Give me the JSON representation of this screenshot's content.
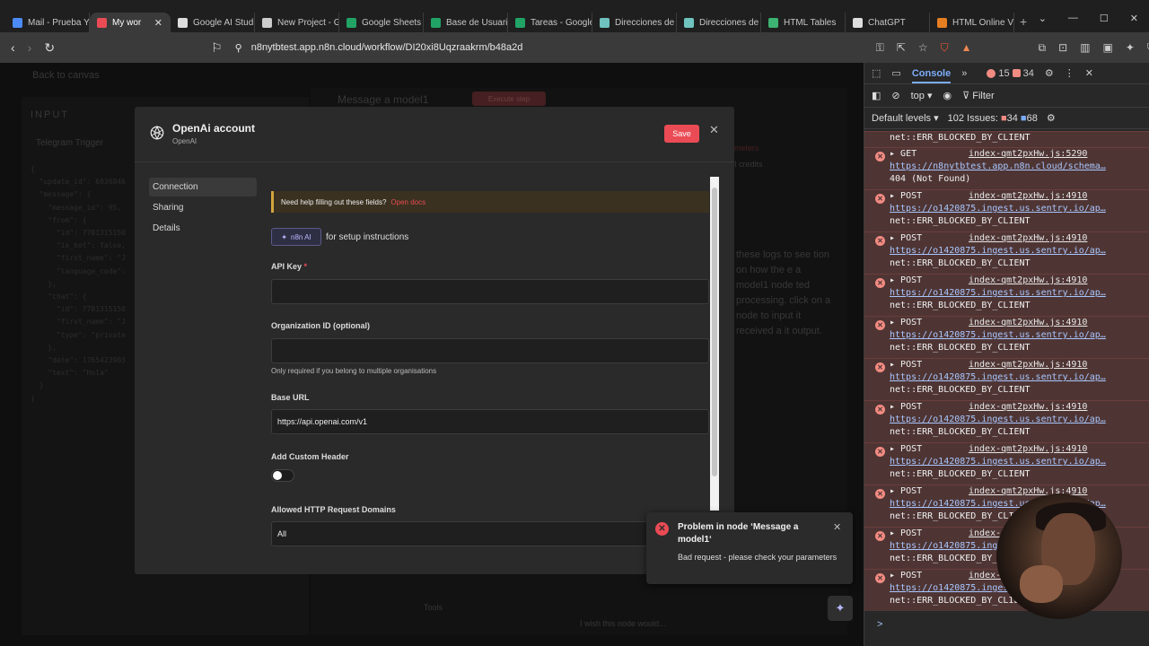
{
  "browser": {
    "tabs": [
      {
        "label": "Mail - Prueba Y",
        "color": "#4c8bf5"
      },
      {
        "label": "My wor",
        "color": "#ea4b54",
        "active": true
      },
      {
        "label": "Google AI Studi",
        "color": "#dddddd"
      },
      {
        "label": "New Project - G",
        "color": "#cccccc"
      },
      {
        "label": "Google Sheets",
        "color": "#21a366"
      },
      {
        "label": "Base de Usuario",
        "color": "#21a366"
      },
      {
        "label": "Tareas - Google",
        "color": "#21a366"
      },
      {
        "label": "Direcciones de",
        "color": "#6fc3bf"
      },
      {
        "label": "Direcciones de",
        "color": "#6fc3bf"
      },
      {
        "label": "HTML Tables",
        "color": "#3cb371"
      },
      {
        "label": "ChatGPT",
        "color": "#dddddd"
      },
      {
        "label": "HTML Online V",
        "color": "#e67e22"
      }
    ],
    "new_tab": "+",
    "url": "n8nytbtest.app.n8n.cloud/workflow/DI20xi8Uqzraakrm/b48a2d"
  },
  "background": {
    "back_to_canvas": "Back to canvas",
    "input_label": "INPUT",
    "telegram_trigger": "Telegram Trigger",
    "json_lines": [
      "{",
      "  \"update_id\": 6936846",
      "  \"message\": {",
      "    \"message_id\": 95,",
      "    \"from\": {",
      "      \"id\": 7781315150",
      "      \"is_bot\": false,",
      "      \"first_name\": \"J",
      "      \"language_code\":",
      "    },",
      "    \"chat\": {",
      "      \"id\": 7781315150",
      "      \"first_name\": \"J",
      "      \"type\": \"private",
      "    },",
      "    \"date\": 1765423903",
      "    \"text\": \"Hola\"",
      "  }",
      "}"
    ],
    "node_title": "Message a model1",
    "execute_step": "Execute step",
    "right_panel_text": "these logs to see tion on how the e a model1 node ted processing. click on a node to input it received a it output.",
    "parameters_tab": "meters",
    "credits": "I credits",
    "tools": "Tools",
    "wish_text": "I wish this node would..."
  },
  "modal": {
    "title": "OpenAi account",
    "subtitle": "OpenAI",
    "save_label": "Save",
    "nav": [
      "Connection",
      "Sharing",
      "Details"
    ],
    "help_text": "Need help filling out these fields?",
    "open_docs": "Open docs",
    "n8n_ai": "n8n AI",
    "setup_text": "for setup instructions",
    "api_key_label": "API Key",
    "required_mark": "*",
    "api_key_value": "",
    "org_label": "Organization ID (optional)",
    "org_value": "",
    "org_hint": "Only required if you belong to multiple organisations",
    "base_url_label": "Base URL",
    "base_url_value": "https://api.openai.com/v1",
    "custom_header_label": "Add Custom Header",
    "custom_header_on": false,
    "domains_label": "Allowed HTTP Request Domains",
    "domains_value": "All"
  },
  "toast": {
    "title": "Problem in node ‘Message a model1‘",
    "message": "Bad request - please check your parameters"
  },
  "devtools": {
    "tab": "Console",
    "errors": "15",
    "issues_small": "34",
    "context": "top",
    "filter": "Filter",
    "levels": "Default levels",
    "issues_label": "102 Issues:",
    "issues_err": "34",
    "issues_info": "68",
    "first_line": "net::ERR_BLOCKED_BY_CLIENT",
    "logs": [
      {
        "method": "GET",
        "src": "index-qmt2pxHw.js:5290",
        "url": "https://n8nytbtest.app.n8n.cloud/schema…",
        "msg": "404 (Not Found)"
      },
      {
        "method": "POST",
        "src": "index-qmt2pxHw.js:4910",
        "url": "https://o1420875.ingest.us.sentry.io/ap…",
        "msg": "net::ERR_BLOCKED_BY_CLIENT"
      },
      {
        "method": "POST",
        "src": "index-qmt2pxHw.js:4910",
        "url": "https://o1420875.ingest.us.sentry.io/ap…",
        "msg": "net::ERR_BLOCKED_BY_CLIENT"
      },
      {
        "method": "POST",
        "src": "index-qmt2pxHw.js:4910",
        "url": "https://o1420875.ingest.us.sentry.io/ap…",
        "msg": "net::ERR_BLOCKED_BY_CLIENT"
      },
      {
        "method": "POST",
        "src": "index-qmt2pxHw.js:4910",
        "url": "https://o1420875.ingest.us.sentry.io/ap…",
        "msg": "net::ERR_BLOCKED_BY_CLIENT"
      },
      {
        "method": "POST",
        "src": "index-qmt2pxHw.js:4910",
        "url": "https://o1420875.ingest.us.sentry.io/ap…",
        "msg": "net::ERR_BLOCKED_BY_CLIENT"
      },
      {
        "method": "POST",
        "src": "index-qmt2pxHw.js:4910",
        "url": "https://o1420875.ingest.us.sentry.io/ap…",
        "msg": "net::ERR_BLOCKED_BY_CLIENT"
      },
      {
        "method": "POST",
        "src": "index-qmt2pxHw.js:4910",
        "url": "https://o1420875.ingest.us.sentry.io/ap…",
        "msg": "net::ERR_BLOCKED_BY_CLIENT"
      },
      {
        "method": "POST",
        "src": "index-qmt2pxHw.js:4910",
        "url": "https://o1420875.ingest.us.sentry.io/ap…",
        "msg": "net::ERR_BLOCKED_BY_CLIENT"
      },
      {
        "method": "POST",
        "src": "index-qmt2pxHw.js:4910",
        "url": "https://o1420875.ingest.us.sentry.io/ap…",
        "msg": "net::ERR_BLOCKED_BY_CLIENT"
      },
      {
        "method": "POST",
        "src": "index-qmt2pxHw.js:4910",
        "url": "https://o1420875.ingest.us.sentry.io/ap…",
        "msg": "net::ERR_BLOCKED_BY_CLIENT"
      }
    ],
    "prompt": ">"
  },
  "colors": {
    "accent": "#ea4b54",
    "help_border": "#d3a43c",
    "devtools_error_bg": "#4e3534"
  }
}
